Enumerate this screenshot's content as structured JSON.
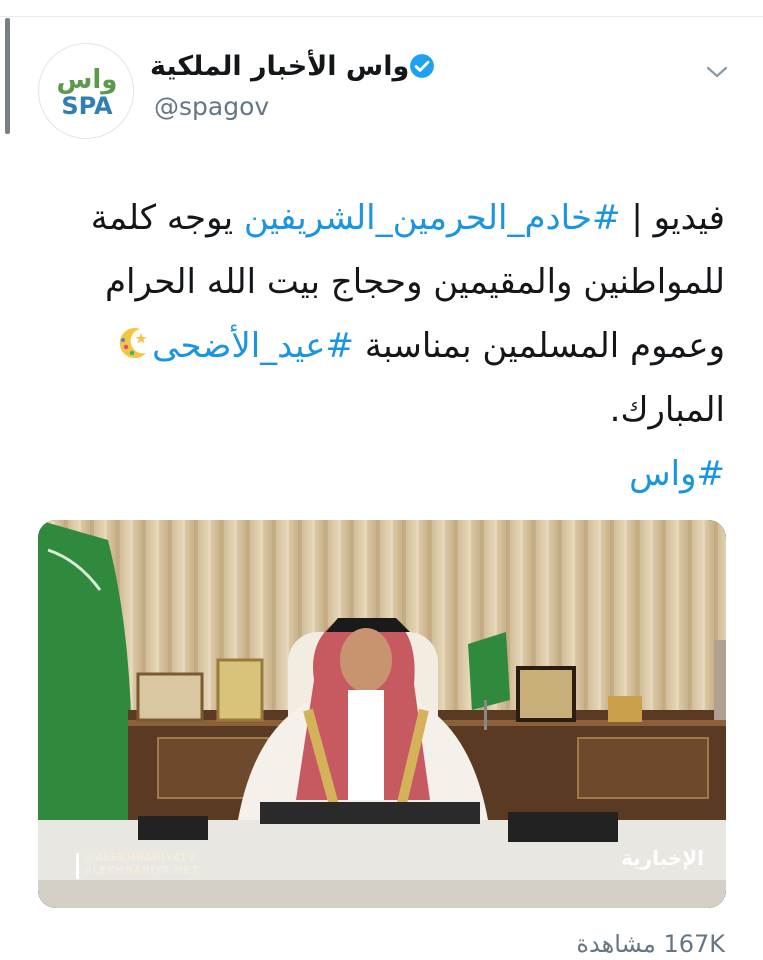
{
  "tweet": {
    "display_name": "واس الأخبار الملكية",
    "handle": "@spagov",
    "avatar_logo_text": {
      "arabic": "واس",
      "latin": "SPA"
    },
    "verified": true,
    "text": {
      "prefix": "فيديو | ",
      "hashtag_1": "#خادم_الحرمين_الشريفين",
      "middle": " يوجه كلمة للمواطنين والمقيمين وحجاج بيت الله الحرام وعموم المسلمين بمناسبة ",
      "hashtag_2": "#عيد_الأضحى",
      "suffix": " المبارك.",
      "hashtag_3": "#واس"
    },
    "video": {
      "watermark_handle": "@ALEKHBARIYATV",
      "watermark_site": "ALEKHBARIYA.NET",
      "channel_logo": "الإخبارية"
    },
    "views": "167K مشاهدة"
  },
  "icons": {
    "verified": "verified-badge-icon",
    "chevron": "chevron-down-icon",
    "emoji": "crescent-moon-star-emoji"
  },
  "colors": {
    "link": "#1b95e0",
    "verified_badge": "#1da1f2",
    "secondary_text": "#657786",
    "logo_green": "#5a9a4a",
    "logo_blue": "#2f7fb0"
  }
}
